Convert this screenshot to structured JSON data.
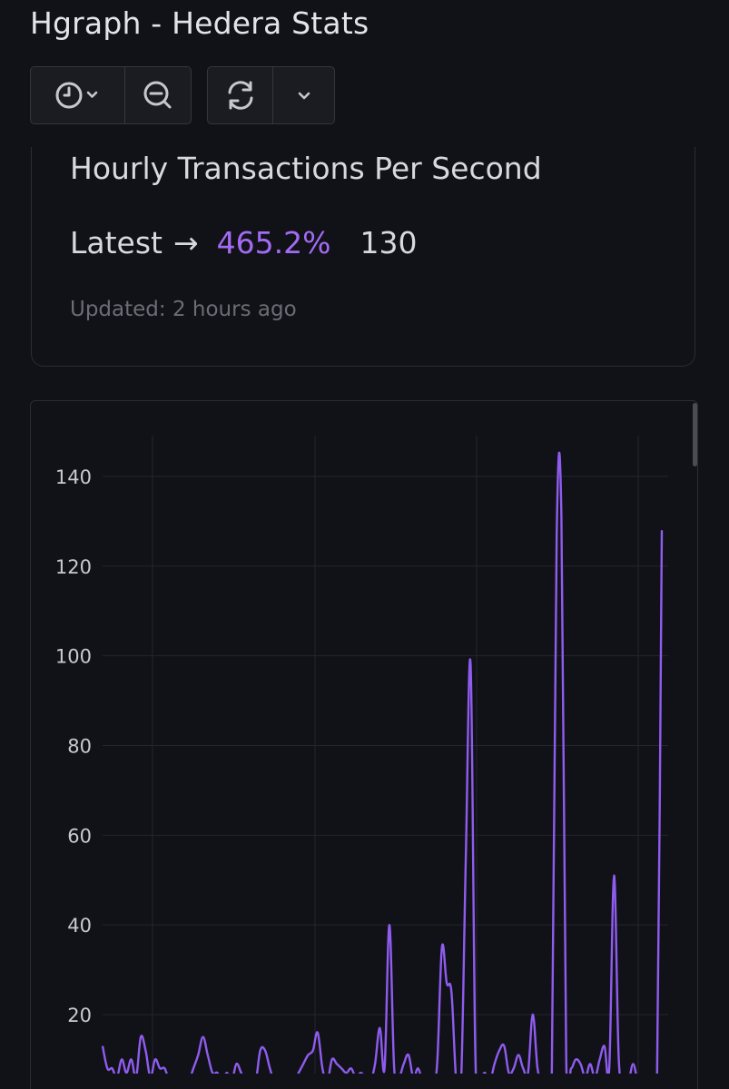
{
  "header": {
    "title": "Hgraph - Hedera Stats"
  },
  "toolbar": {
    "icons": [
      "clock-icon",
      "chevron-down-icon",
      "zoom-out-icon",
      "refresh-icon",
      "chevron-down-icon"
    ]
  },
  "stat": {
    "heading": "Hourly Transactions Per Second",
    "latest_label": "Latest",
    "arrow": "→",
    "percent": "465.2%",
    "value": "130",
    "updated": "Updated: 2 hours ago"
  },
  "colors": {
    "accent": "#a36bf5",
    "line": "#8f5cf0",
    "background": "#111217",
    "panel_border": "#2b2d33"
  },
  "chart_data": {
    "type": "line",
    "title": "",
    "xlabel": "",
    "ylabel": "",
    "ylim": [
      0,
      150
    ],
    "yticks": [
      20,
      40,
      60,
      80,
      100,
      120,
      140
    ],
    "grid": true,
    "series": [
      {
        "values": [
          13,
          8,
          8,
          6,
          10,
          7,
          10,
          6,
          15,
          12,
          6,
          10,
          8,
          8,
          5,
          4,
          5,
          4,
          5,
          8,
          11,
          15,
          11,
          7,
          7,
          5,
          7,
          5,
          9,
          7,
          5,
          6,
          5,
          12,
          12,
          8,
          5,
          6,
          5,
          6,
          5,
          7,
          9,
          11,
          12,
          16,
          8,
          5,
          10,
          9,
          8,
          7,
          8,
          6,
          7,
          6,
          5,
          9,
          17,
          8,
          40,
          8,
          6,
          9,
          11,
          6,
          8,
          5,
          5,
          5,
          9,
          35,
          27,
          25,
          5,
          5,
          55,
          98,
          10,
          6,
          7,
          5,
          9,
          12,
          13,
          7,
          8,
          11,
          8,
          7,
          20,
          8,
          5,
          5,
          8,
          127,
          131,
          10,
          8,
          10,
          9,
          6,
          9,
          6,
          10,
          13,
          8,
          51,
          10,
          6,
          5,
          9,
          5,
          5,
          5,
          6,
          5,
          128
        ]
      }
    ]
  }
}
